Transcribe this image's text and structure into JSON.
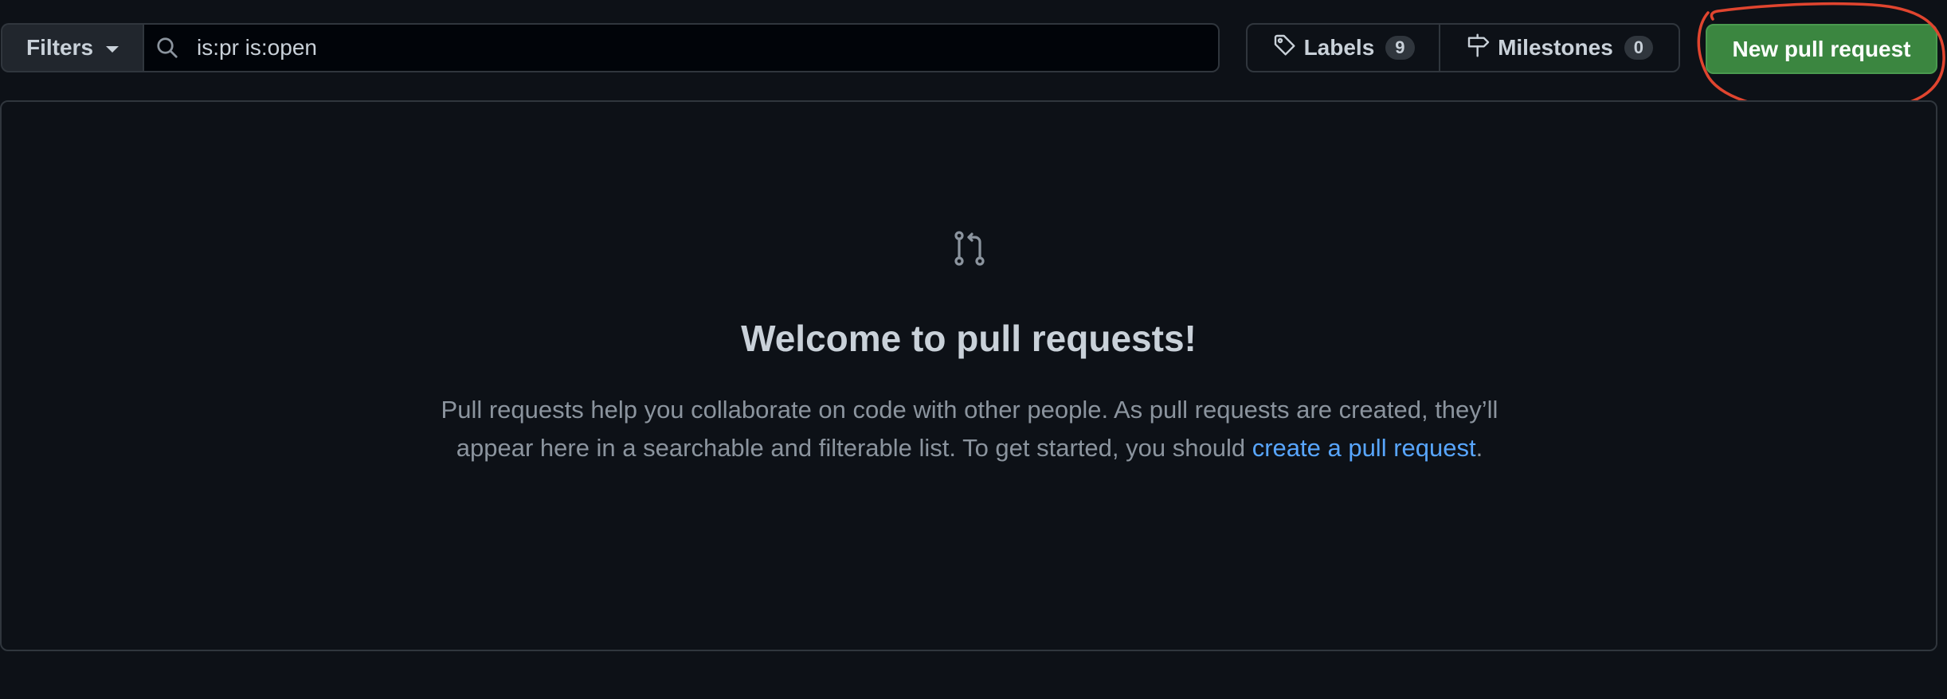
{
  "toolbar": {
    "filters_label": "Filters",
    "search_value": "is:pr is:open",
    "labels_label": "Labels",
    "labels_count": "9",
    "milestones_label": "Milestones",
    "milestones_count": "0",
    "new_pr_label": "New pull request"
  },
  "blankslate": {
    "title": "Welcome to pull requests!",
    "text_before_link": "Pull requests help you collaborate on code with other people. As pull requests are created, they’ll appear here in a searchable and filterable list. To get started, you should ",
    "link_text": "create a pull request",
    "text_after_link": "."
  },
  "icons": {
    "filters_caret": "chevron-down-icon",
    "search": "search-icon",
    "labels": "tag-icon",
    "milestones": "milestone-icon",
    "blankslate": "git-pull-request-icon"
  },
  "colors": {
    "background": "#0d1117",
    "primary_button": "#3b8640",
    "link": "#58a6ff",
    "annotation": "#e0452f"
  }
}
